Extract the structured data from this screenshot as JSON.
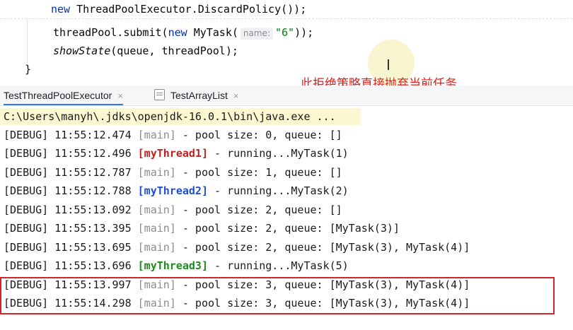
{
  "editor": {
    "line1": {
      "kw": "new",
      "text": "ThreadPoolExecutor.DiscardPolicy());"
    },
    "line2": {
      "pre": "threadPool.submit(",
      "kw": "new",
      "cls": "MyTask(",
      "hint": "name:",
      "str": "\"6\"",
      "post": "));"
    },
    "line3": {
      "method": "showState",
      "rest": "(queue, threadPool);"
    },
    "line4": {
      "text": "}"
    }
  },
  "annotation": "此拒绝策略直接抛弃当前任务",
  "tabs": [
    {
      "label": "TestThreadPoolExecutor",
      "close": "×",
      "active": true
    },
    {
      "label": "TestArrayList",
      "close": "×",
      "active": false
    }
  ],
  "console": {
    "command": "C:\\Users\\manyh\\.jdks\\openjdk-16.0.1\\bin\\java.exe ...",
    "lines": [
      {
        "level": "[DEBUG]",
        "time": "11:55:12.474",
        "thread": "[main]",
        "msg": "- pool size: 0, queue: []",
        "style": "th"
      },
      {
        "level": "[DEBUG]",
        "time": "11:55:12.496",
        "thread": "[myThread1]",
        "msg": "- running...MyTask(1)",
        "style": "t1"
      },
      {
        "level": "[DEBUG]",
        "time": "11:55:12.787",
        "thread": "[main]",
        "msg": "- pool size: 1, queue: []",
        "style": "th"
      },
      {
        "level": "[DEBUG]",
        "time": "11:55:12.788",
        "thread": "[myThread2]",
        "msg": "- running...MyTask(2)",
        "style": "t2"
      },
      {
        "level": "[DEBUG]",
        "time": "11:55:13.092",
        "thread": "[main]",
        "msg": "- pool size: 2, queue: []",
        "style": "th"
      },
      {
        "level": "[DEBUG]",
        "time": "11:55:13.395",
        "thread": "[main]",
        "msg": "- pool size: 2, queue: [MyTask(3)]",
        "style": "th"
      },
      {
        "level": "[DEBUG]",
        "time": "11:55:13.695",
        "thread": "[main]",
        "msg": "- pool size: 2, queue: [MyTask(3), MyTask(4)]",
        "style": "th"
      },
      {
        "level": "[DEBUG]",
        "time": "11:55:13.696",
        "thread": "[myThread3]",
        "msg": "- running...MyTask(5)",
        "style": "t3"
      },
      {
        "level": "[DEBUG]",
        "time": "11:55:13.997",
        "thread": "[main]",
        "msg": "- pool size: 3, queue: [MyTask(3), MyTask(4)]",
        "style": "th"
      },
      {
        "level": "[DEBUG]",
        "time": "11:55:14.298",
        "thread": "[main]",
        "msg": "- pool size: 3, queue: [MyTask(3), MyTask(4)]",
        "style": "th"
      }
    ]
  },
  "colors": {
    "annotation": "#e0201b",
    "highlight_box": "#d7222a",
    "thread1": "#c41f1f",
    "thread2": "#1f4fd6",
    "thread3": "#1d8a1d"
  }
}
